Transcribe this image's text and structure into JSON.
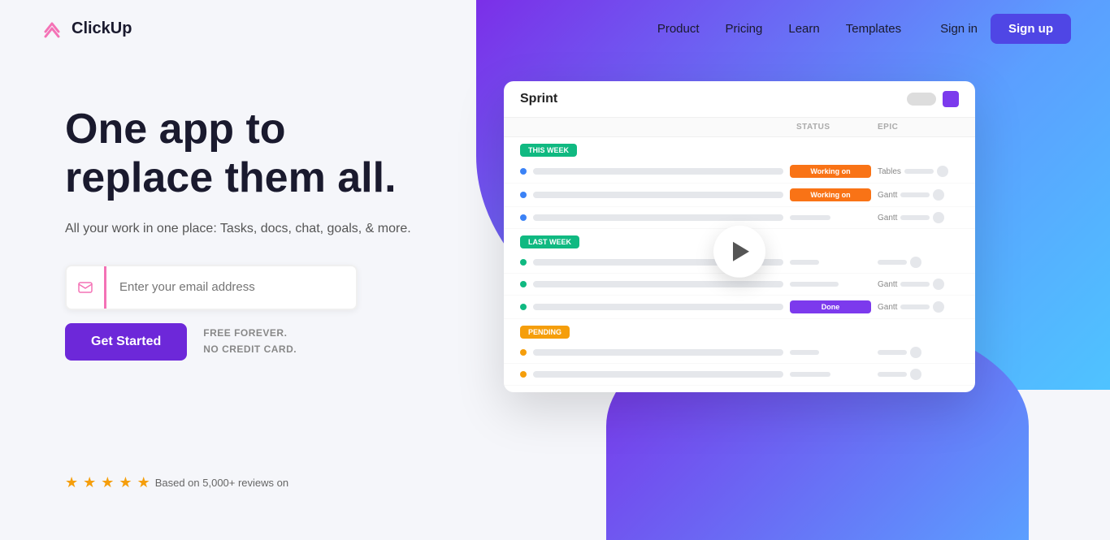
{
  "brand": {
    "name": "ClickUp"
  },
  "nav": {
    "links": [
      {
        "label": "Product",
        "id": "product"
      },
      {
        "label": "Pricing",
        "id": "pricing"
      },
      {
        "label": "Learn",
        "id": "learn"
      },
      {
        "label": "Templates",
        "id": "templates"
      }
    ],
    "signin_label": "Sign in",
    "signup_label": "Sign up"
  },
  "hero": {
    "title_line1": "One app to",
    "title_line2": "replace them all.",
    "subtitle": "All your work in one place: Tasks, docs, chat, goals, & more.",
    "email_placeholder": "Enter your email address",
    "cta_button": "Get Started",
    "free_text_line1": "FREE FOREVER.",
    "free_text_line2": "NO CREDIT CARD."
  },
  "app_preview": {
    "title": "Sprint",
    "section_this_week": "THIS WEEK",
    "section_last_week": "LAST WEEK",
    "section_pending": "PENDING",
    "col_status": "STATUS",
    "col_epic": "EPIC",
    "rows_this_week": [
      {
        "dot": "blue",
        "status": "Working on",
        "epic": "Tables"
      },
      {
        "dot": "blue",
        "status": "Working on",
        "epic": "Gantt"
      },
      {
        "dot": "blue",
        "status": "",
        "epic": "Gantt"
      }
    ],
    "rows_last_week": [
      {
        "dot": "green",
        "status": "",
        "epic": ""
      },
      {
        "dot": "green",
        "status": "",
        "epic": "Gantt"
      },
      {
        "dot": "green",
        "status": "Done",
        "epic": "Gantt"
      }
    ],
    "rows_pending": [
      {
        "dot": "yellow",
        "status": "",
        "epic": ""
      },
      {
        "dot": "yellow",
        "status": "",
        "epic": ""
      }
    ]
  },
  "reviews": {
    "stars": 5,
    "text": "Based on 5,000+ reviews on"
  }
}
